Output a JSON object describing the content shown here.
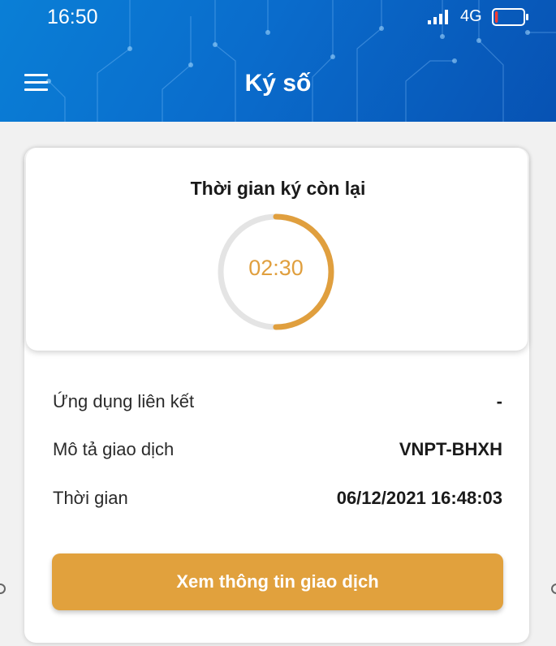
{
  "status_bar": {
    "time": "16:50",
    "network": "4G",
    "battery_level_fraction": 0.1
  },
  "header": {
    "menu_icon": "hamburger-menu-icon",
    "title": "Ký số"
  },
  "timer": {
    "label": "Thời gian ký còn lại",
    "value": "02:30",
    "progress_fraction": 0.5,
    "color": "#e09f3e"
  },
  "details": {
    "rows": [
      {
        "label": "Ứng dụng liên kết",
        "value": "-"
      },
      {
        "label": "Mô tả giao dịch",
        "value": "VNPT-BHXH"
      },
      {
        "label": "Thời gian",
        "value": "06/12/2021 16:48:03"
      }
    ]
  },
  "action": {
    "label": "Xem thông tin giao dịch",
    "color": "#e1a13d"
  },
  "colors": {
    "header_blue": "#0a6ccc",
    "accent_orange": "#e1a13d"
  }
}
